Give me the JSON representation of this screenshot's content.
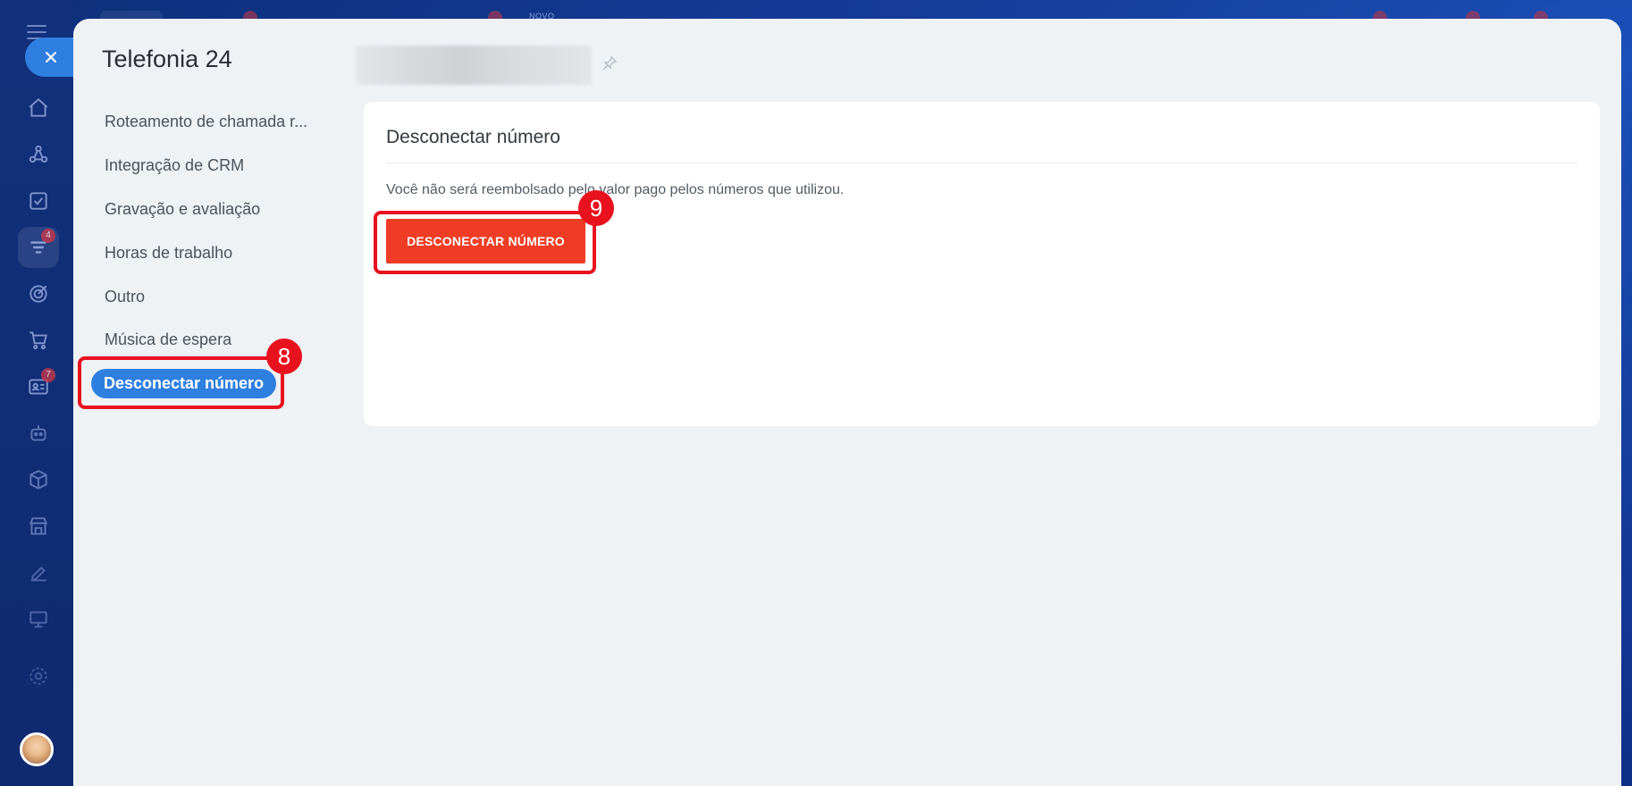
{
  "rail": {
    "badges": {
      "tasks": "4",
      "contacts": "7"
    }
  },
  "header": {
    "novo_label": "NOVO"
  },
  "panel": {
    "title": "Telefonia 24"
  },
  "nav": {
    "items": [
      {
        "label": "Roteamento de chamada r..."
      },
      {
        "label": "Integração de CRM"
      },
      {
        "label": "Gravação e avaliação"
      },
      {
        "label": "Horas de trabalho"
      },
      {
        "label": "Outro"
      },
      {
        "label": "Música de espera"
      },
      {
        "label": "Desconectar número",
        "active": true
      }
    ]
  },
  "content": {
    "title": "Desconectar número",
    "message": "Você não será reembolsado pelo valor pago pelos números que utilizou.",
    "button_label": "DESCONECTAR NÚMERO"
  },
  "annotations": {
    "step_8": "8",
    "step_9": "9"
  },
  "colors": {
    "accent_blue": "#2f7fe0",
    "danger_red": "#ef3d25",
    "annotation_red": "#e8111e"
  }
}
